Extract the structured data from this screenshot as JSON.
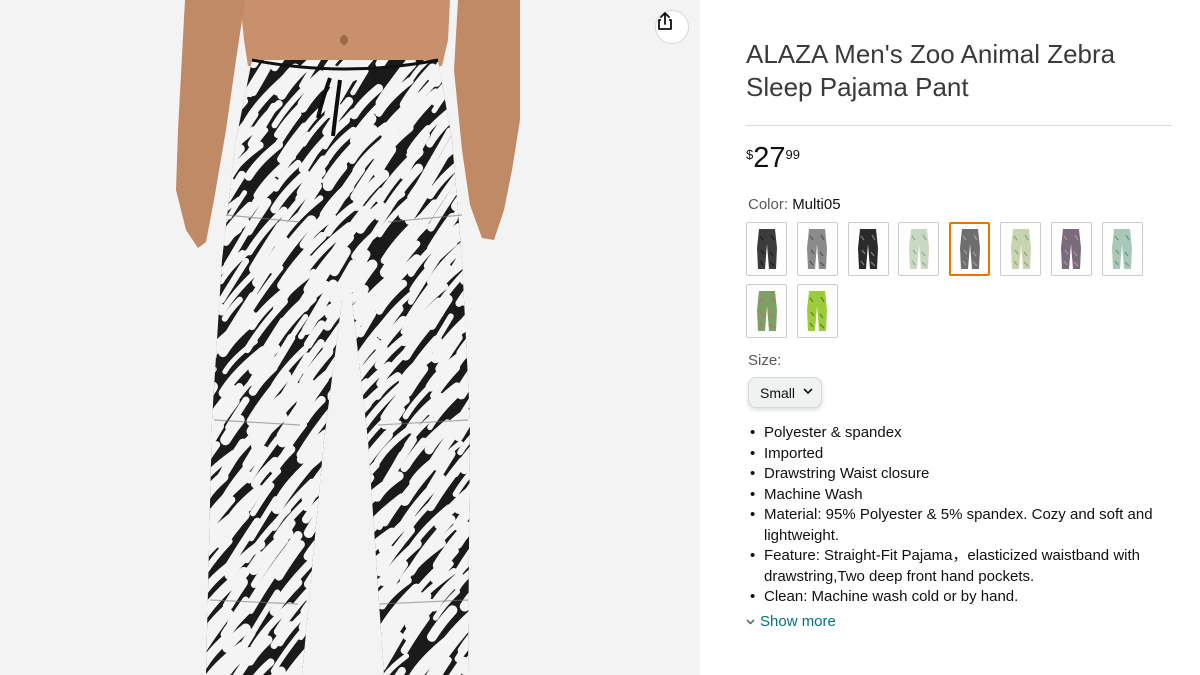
{
  "product": {
    "title": "ALAZA Men's Zoo Animal Zebra Sleep Pajama Pant",
    "price": {
      "symbol": "$",
      "whole": "27",
      "fraction": "99"
    }
  },
  "color": {
    "label": "Color:",
    "selected": "Multi05",
    "swatches": [
      {
        "tone": "#3c3c3c",
        "accent": "#1f1f1f"
      },
      {
        "tone": "#8b8b8b",
        "accent": "#5a5a5a"
      },
      {
        "tone": "#2a2a2a",
        "accent": "#7a7a7a"
      },
      {
        "tone": "#c9d8c0",
        "accent": "#8fb0a8"
      },
      {
        "tone": "#6e6e6e",
        "accent": "#9a9a9a"
      },
      {
        "tone": "#c8d3b0",
        "accent": "#8ea878"
      },
      {
        "tone": "#7a6b7a",
        "accent": "#b48aa4"
      },
      {
        "tone": "#a8c8b8",
        "accent": "#6c9e8a"
      },
      {
        "tone": "#7fa064",
        "accent": "#c46a6a"
      },
      {
        "tone": "#9ccc3c",
        "accent": "#5f8a1e"
      }
    ],
    "selected_index": 4
  },
  "size": {
    "label": "Size:",
    "value": "Small"
  },
  "bullets": [
    "Polyester & spandex",
    "Imported",
    "Drawstring Waist closure",
    "Machine Wash",
    "Material: 95% Polyester & 5% spandex. Cozy and soft and lightweight.",
    "Feature: Straight-Fit Pajama，elasticized waistband with drawstring,Two deep front hand pockets.",
    "Clean: Machine wash cold or by hand."
  ],
  "show_more": "Show more",
  "icons": {
    "share": "share-icon",
    "chevron": "chevron-down-icon"
  },
  "colors": {
    "link": "#007185",
    "selected_border": "#e77600",
    "text": "#0f1111",
    "muted": "#565959"
  }
}
